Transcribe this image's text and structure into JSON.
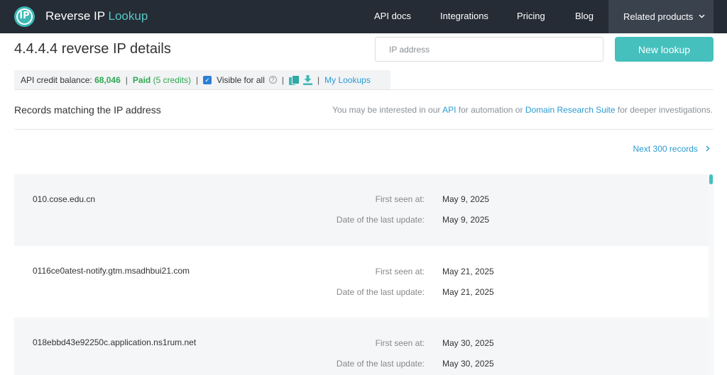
{
  "nav": {
    "logo_text": "IP",
    "brand_main": "Reverse IP",
    "brand_accent": "Lookup",
    "items": [
      "API docs",
      "Integrations",
      "Pricing",
      "Blog"
    ],
    "related": "Related products"
  },
  "header": {
    "title": "4.4.4.4 reverse IP details",
    "ip_placeholder": "IP address",
    "new_lookup": "New lookup"
  },
  "credit": {
    "balance_label": "API credit balance:",
    "balance_value": "68,046",
    "paid_label": "Paid",
    "paid_credits": "(5 credits)",
    "visible_label": "Visible for all",
    "my_lookups": "My Lookups"
  },
  "records_section": {
    "label": "Records matching the IP address",
    "interest_prefix": "You may be interested in our",
    "api_link": "API",
    "interest_mid": "for automation or",
    "suite_link": "Domain Research Suite",
    "interest_suffix": "for deeper investigations.",
    "next_records": "Next 300 records"
  },
  "labels": {
    "first_seen": "First seen at:",
    "last_update": "Date of the last update:"
  },
  "records": [
    {
      "domain": "010.cose.edu.cn",
      "first_seen": "May 9, 2025",
      "last_update": "May 9, 2025"
    },
    {
      "domain": "0116ce0atest-notify.gtm.msadhbui21.com",
      "first_seen": "May 21, 2025",
      "last_update": "May 21, 2025"
    },
    {
      "domain": "018ebbd43e92250c.application.ns1rum.net",
      "first_seen": "May 30, 2025",
      "last_update": "May 30, 2025"
    }
  ],
  "colors": {
    "topbar": "#252c35",
    "accent": "#45c0bd",
    "link": "#2a9bd0",
    "green": "#2fa84f"
  }
}
